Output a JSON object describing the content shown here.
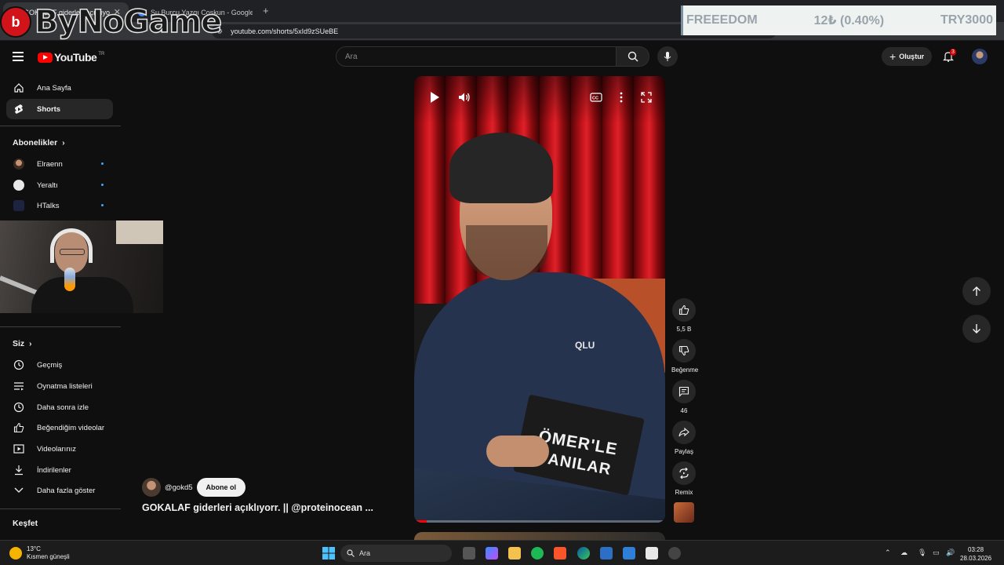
{
  "browser": {
    "tabs": [
      {
        "title": "GOKALAF giderleri açıklıyorr.",
        "active": true
      },
      {
        "title": "Su Burcu Yazgı Coşkun - Google'da A",
        "active": false
      }
    ],
    "url": "youtube.com/shorts/5xId9zSUeBE"
  },
  "watermark": {
    "text": "ByNoGame"
  },
  "ticker": {
    "name": "FREEEDOM",
    "change": "12₺ (0.40%)",
    "goal": "TRY3000"
  },
  "youtube": {
    "logo_text": "YouTube",
    "country": "TR",
    "search_placeholder": "Ara",
    "create_label": "Oluştur",
    "notification_count": "3"
  },
  "sidebar": {
    "main": [
      {
        "label": "Ana Sayfa",
        "icon": "home-icon"
      },
      {
        "label": "Shorts",
        "icon": "shorts-icon",
        "active": true
      }
    ],
    "subscriptions_title": "Abonelikler",
    "subscriptions": [
      {
        "label": "Elraenn"
      },
      {
        "label": "Yeraltı"
      },
      {
        "label": "HTalks"
      }
    ],
    "you_title": "Siz",
    "you": [
      {
        "label": "Geçmiş",
        "icon": "history-icon"
      },
      {
        "label": "Oynatma listeleri",
        "icon": "playlist-icon"
      },
      {
        "label": "Daha sonra izle",
        "icon": "clock-icon"
      },
      {
        "label": "Beğendiğim videolar",
        "icon": "like-icon"
      },
      {
        "label": "Videolarınız",
        "icon": "video-icon"
      },
      {
        "label": "İndirilenler",
        "icon": "download-icon"
      },
      {
        "label": "Daha fazla göster",
        "icon": "chevron-down-icon"
      }
    ],
    "explore_title": "Keşfet"
  },
  "short": {
    "channel": "@gokd5",
    "subscribe_label": "Abone ol",
    "title": "GOKALAF giderleri açıklıyorr. || @proteinocean ...",
    "overlay_line1": "ÖMER'LE",
    "overlay_line2": "ANILAR",
    "shirt_brand": "QLU",
    "progress": 0.05,
    "actions": {
      "likes": "5,5 B",
      "dislike_label": "Beğenme",
      "comments": "46",
      "share_label": "Paylaş",
      "remix_label": "Remix"
    }
  },
  "taskbar": {
    "weather_temp": "13°C",
    "weather_desc": "Kısmen güneşli",
    "search_label": "Ara",
    "time": "03:28",
    "date": "28.03.2026"
  },
  "colors": {
    "accent": "#ff0000",
    "link": "#3ea6ff",
    "bg": "#0f0f0f"
  }
}
